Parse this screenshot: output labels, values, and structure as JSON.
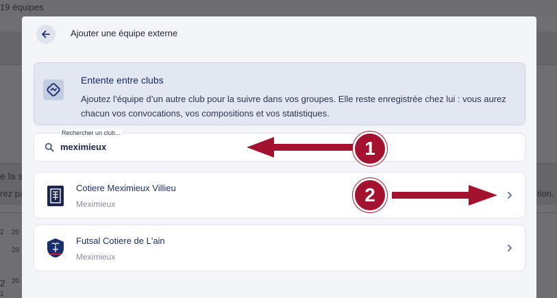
{
  "background": {
    "header_text": "19 équipes",
    "side_text_1": "e la s",
    "side_text_2": "rez pa",
    "side_text_3": "tion.",
    "row_num_1": "2",
    "row_num_2": "2",
    "row_cell_1": "20",
    "row_cell_2": "20",
    "row_cell_3": "20",
    "row_cell_4": "1"
  },
  "modal": {
    "title": "Ajouter une équipe externe"
  },
  "info": {
    "title": "Entente entre clubs",
    "text": "Ajoutez l’équipe d’un autre club pour la suivre dans vos groupes. Elle reste enregistrée chez lui : vous aurez chacun vos convocations, vos compositions et vos statistiques."
  },
  "search": {
    "label": "Rechercher un club...",
    "value": "meximieux"
  },
  "results": [
    {
      "name": "Cotiere Meximieux Villieu",
      "city": "Meximieux"
    },
    {
      "name": "Futsal Cotiere de L'ain",
      "city": "Meximieux"
    }
  ],
  "annotations": {
    "badge_1": "1",
    "badge_2": "2",
    "color": "#a3122f"
  }
}
